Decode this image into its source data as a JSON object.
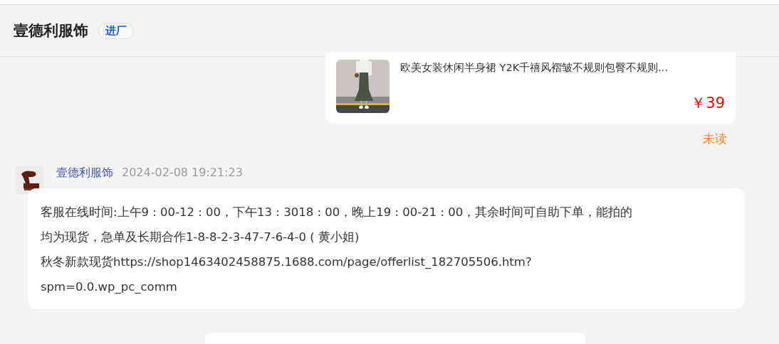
{
  "header": {
    "title": "壹德利服饰",
    "badge": "进厂"
  },
  "product_card": {
    "title": "欧美女装休闲半身裙 Y2K千禧风褶皱不规则包臀不规则...",
    "price": "￥39"
  },
  "read_status": "未读",
  "message": {
    "sender": "壹德利服饰",
    "time": "2024-02-08 19:21:23",
    "lines": [
      "客服在线时间:上午9 : 00-12 : 00，下午13 : 3018 : 00，晚上19 : 00-21 : 00，其余时间可自助下单，能拍的",
      "均为现货，急单及长期合作1-8-8-2-3-47-7-6-4-0 ( 黄小姐)",
      "秋冬新款现货https://shop1463402458875.1688.com/page/offerlist_182705506.htm?",
      "spm=0.0.wp_pc_comm"
    ]
  }
}
